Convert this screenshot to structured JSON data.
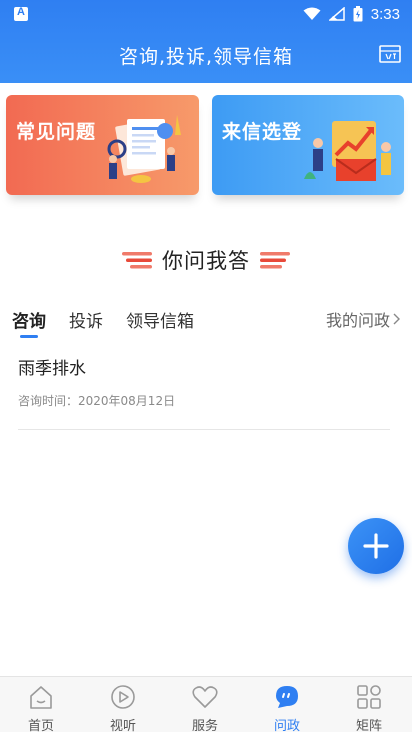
{
  "status_bar": {
    "time": "3:33"
  },
  "header": {
    "title": "咨询,投诉,领导信箱",
    "mail_icon": "mailbox-icon"
  },
  "banners": [
    {
      "label": "常见问题",
      "color": "#f26a52"
    },
    {
      "label": "来信选登",
      "color": "#3d9bf4"
    }
  ],
  "section": {
    "title": "你问我答"
  },
  "tabs": [
    {
      "label": "咨询",
      "active": true
    },
    {
      "label": "投诉",
      "active": false
    },
    {
      "label": "领导信箱",
      "active": false
    }
  ],
  "my_link": "我的问政",
  "list": [
    {
      "title": "雨季排水",
      "meta": "咨询时间：2020年08月12日"
    }
  ],
  "nav": [
    {
      "label": "首页",
      "icon": "home-icon",
      "active": false
    },
    {
      "label": "视听",
      "icon": "play-icon",
      "active": false
    },
    {
      "label": "服务",
      "icon": "heart-icon",
      "active": false
    },
    {
      "label": "问政",
      "icon": "chat-bubble-icon",
      "active": true
    },
    {
      "label": "矩阵",
      "icon": "grid-icon",
      "active": false
    }
  ],
  "colors": {
    "accent": "#2f7ff2",
    "faq_banner": "#f26a52",
    "visit_banner": "#3d9bf4"
  }
}
